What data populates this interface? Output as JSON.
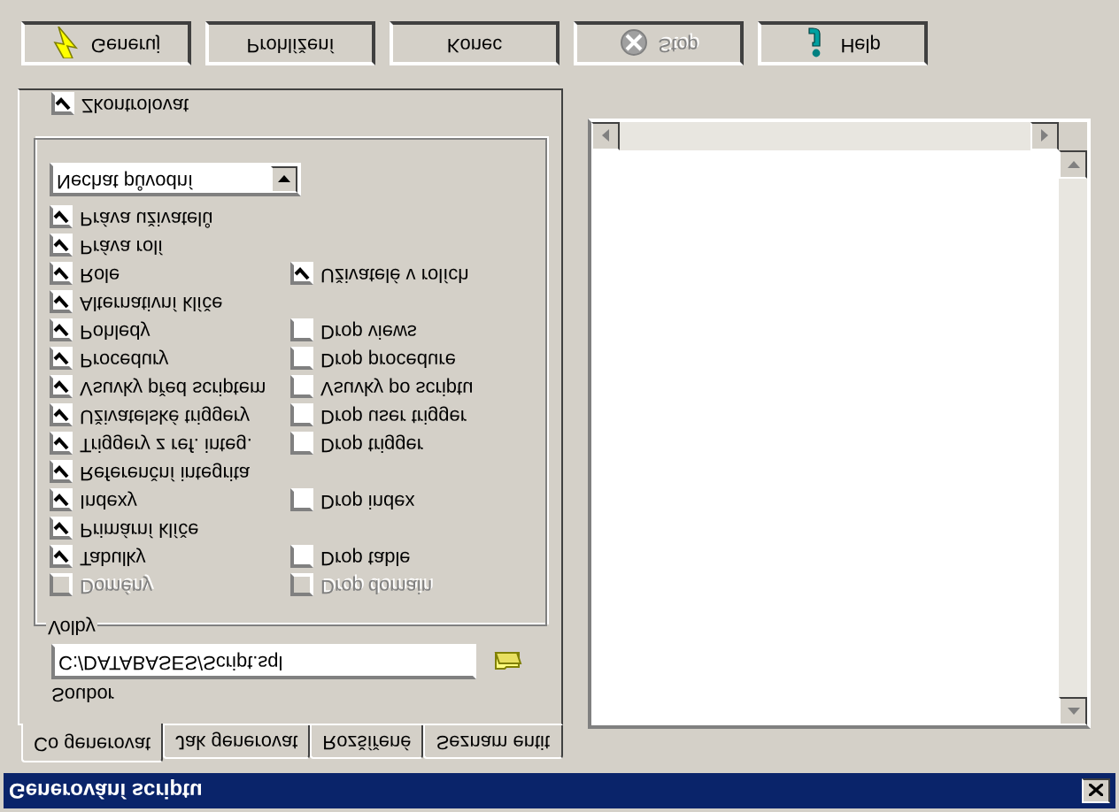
{
  "window": {
    "title": "Generování scriptu"
  },
  "tabs": [
    {
      "label": "Co generovat",
      "selected": true
    },
    {
      "label": "Jak generovat",
      "selected": false
    },
    {
      "label": "Rozšířené",
      "selected": false
    },
    {
      "label": "Seznam entit",
      "selected": false
    }
  ],
  "file": {
    "label": "Soubor",
    "value": "C:/DATABASES/Script.sql"
  },
  "options": {
    "title": "Volby",
    "rows": [
      {
        "left": {
          "label": "Práva uživatelů",
          "checked": true,
          "disabled": false
        }
      },
      {
        "left": {
          "label": "Práva rolí",
          "checked": true,
          "disabled": false
        }
      },
      {
        "left": {
          "label": "Role",
          "checked": true,
          "disabled": false
        },
        "right": {
          "label": "Uživatelé v rolích",
          "checked": true,
          "disabled": false
        }
      },
      {
        "left": {
          "label": "Alternativní klíče",
          "checked": true,
          "disabled": false
        }
      },
      {
        "left": {
          "label": "Pohledy",
          "checked": true,
          "disabled": false
        },
        "right": {
          "label": "Drop views",
          "checked": false,
          "disabled": false
        }
      },
      {
        "left": {
          "label": "Procedury",
          "checked": true,
          "disabled": false
        },
        "right": {
          "label": "Drop procedure",
          "checked": false,
          "disabled": false
        }
      },
      {
        "left": {
          "label": "Vsuvky před scriptem",
          "checked": true,
          "disabled": false
        },
        "right": {
          "label": "Vsuvky po scriptu",
          "checked": false,
          "disabled": false
        }
      },
      {
        "left": {
          "label": "Uživatelské triggery",
          "checked": true,
          "disabled": false
        },
        "right": {
          "label": "Drop user trigger",
          "checked": false,
          "disabled": false
        }
      },
      {
        "left": {
          "label": "Triggery z ref. integ.",
          "checked": true,
          "disabled": false
        },
        "right": {
          "label": "Drop trigger",
          "checked": false,
          "disabled": false
        }
      },
      {
        "left": {
          "label": "Referenční integrita",
          "checked": true,
          "disabled": false
        }
      },
      {
        "left": {
          "label": "Indexy",
          "checked": true,
          "disabled": false
        },
        "right": {
          "label": "Drop index",
          "checked": false,
          "disabled": false
        }
      },
      {
        "left": {
          "label": "Primární klíče",
          "checked": true,
          "disabled": false
        }
      },
      {
        "left": {
          "label": "Tabulky",
          "checked": true,
          "disabled": false
        },
        "right": {
          "label": "Drop table",
          "checked": false,
          "disabled": false
        }
      },
      {
        "left": {
          "label": "Domény",
          "checked": false,
          "disabled": true
        },
        "right": {
          "label": "Drop domain",
          "checked": false,
          "disabled": true
        }
      }
    ],
    "mode_select": {
      "value": "Nechat původní"
    }
  },
  "verify": {
    "label": "Zkontrolovat",
    "checked": true,
    "disabled": false
  },
  "buttons": [
    {
      "label": "Generuj",
      "disabled": false
    },
    {
      "label": "Prohlížení",
      "disabled": false
    },
    {
      "label": "Konec",
      "disabled": false
    },
    {
      "label": "Stop",
      "disabled": true
    },
    {
      "label": "Help",
      "disabled": false
    }
  ]
}
